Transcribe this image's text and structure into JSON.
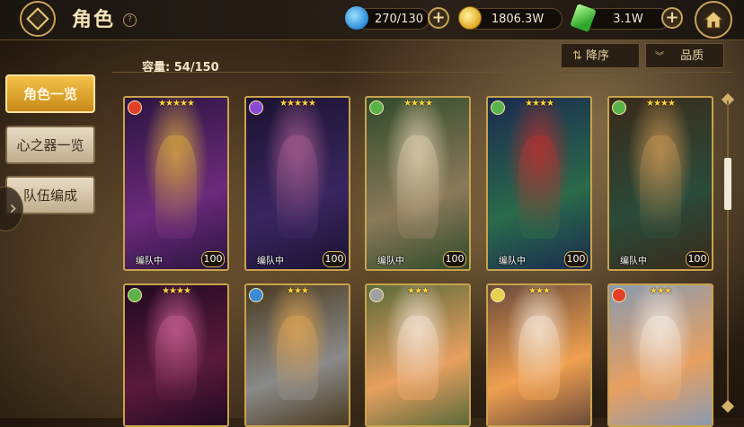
{
  "header": {
    "title": "角色",
    "help": "?",
    "resources": [
      {
        "name": "stamina",
        "icon": "blue-fish-icon",
        "value": "270/130",
        "color": "#3fb4ff"
      },
      {
        "name": "gold",
        "icon": "gold-coin-icon",
        "value": "1806.3W",
        "color": "#f2c133"
      },
      {
        "name": "crystal",
        "icon": "green-crystal-icon",
        "value": "3.1W",
        "color": "#46d14a"
      }
    ],
    "plus": "+"
  },
  "sort": {
    "order_label": "降序",
    "quality_label": "品质"
  },
  "capacity": "容量: 54/150",
  "tabs": [
    {
      "label": "角色一览",
      "active": true
    },
    {
      "label": "心之器一览",
      "active": false
    },
    {
      "label": "队伍编成",
      "active": false
    }
  ],
  "drawer_icon": "›",
  "cards": [
    {
      "stars": "★★★★★",
      "status": "编队中",
      "level": "100",
      "attribute": "fire",
      "attr_color": "#e0402a",
      "palette": [
        "#2a1540",
        "#6b2a7a",
        "#d0a040"
      ]
    },
    {
      "stars": "★★★★★",
      "status": "编队中",
      "level": "100",
      "attribute": "dark",
      "attr_color": "#8a4ad6",
      "palette": [
        "#1a1230",
        "#3a2660",
        "#a05a8a"
      ]
    },
    {
      "stars": "★★★★",
      "status": "编队中",
      "level": "100",
      "attribute": "wind",
      "attr_color": "#5ab24a",
      "palette": [
        "#2f4a2a",
        "#8a7a5a",
        "#d8c8a8"
      ]
    },
    {
      "stars": "★★★★",
      "status": "编队中",
      "level": "100",
      "attribute": "wind",
      "attr_color": "#5ab24a",
      "palette": [
        "#1a2a50",
        "#2a6a4a",
        "#b03030"
      ]
    },
    {
      "stars": "★★★★",
      "status": "编队中",
      "level": "100",
      "attribute": "wind",
      "attr_color": "#5ab24a",
      "palette": [
        "#3a2a1a",
        "#2a4a3a",
        "#c09050"
      ]
    },
    {
      "stars": "★★★★",
      "status": "",
      "level": "",
      "attribute": "wind",
      "attr_color": "#5ab24a",
      "palette": [
        "#200a20",
        "#5a1a3a",
        "#c05a8a"
      ]
    },
    {
      "stars": "★★★",
      "status": "",
      "level": "",
      "attribute": "water",
      "attr_color": "#3a8ad6",
      "palette": [
        "#4a3a20",
        "#8a8a8a",
        "#d8a050"
      ]
    },
    {
      "stars": "★★★",
      "status": "",
      "level": "",
      "attribute": "neutral",
      "attr_color": "#a0a0a0",
      "palette": [
        "#5a6a3a",
        "#e8a060",
        "#f0e0d0"
      ]
    },
    {
      "stars": "★★★",
      "status": "",
      "level": "",
      "attribute": "light",
      "attr_color": "#e8d050",
      "palette": [
        "#6a4a3a",
        "#f0a050",
        "#f0e0d0"
      ]
    },
    {
      "stars": "★★★",
      "status": "",
      "level": "",
      "attribute": "fire",
      "attr_color": "#e0402a",
      "palette": [
        "#8a9ab0",
        "#e8a060",
        "#f0e8e0"
      ]
    }
  ]
}
